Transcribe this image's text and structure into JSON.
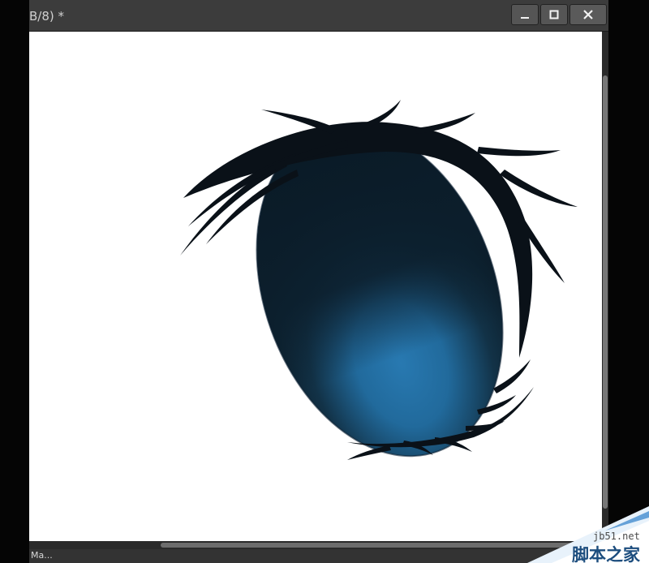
{
  "window": {
    "title": "B/8) *",
    "controls": {
      "minimize": "minimize-icon",
      "maximize": "maximize-icon",
      "close": "close-icon"
    }
  },
  "canvas": {
    "artwork": "anime-eye-illustration",
    "background_color": "#ffffff",
    "iris_top_color": "#0c1e2b",
    "iris_glow_color": "#2672a6",
    "lash_color": "#0a1118"
  },
  "status": {
    "text": "Ma..."
  },
  "watermark": {
    "url": "jb51.net",
    "site_name": "脚本之家",
    "accent_color": "#2e7fc9"
  }
}
